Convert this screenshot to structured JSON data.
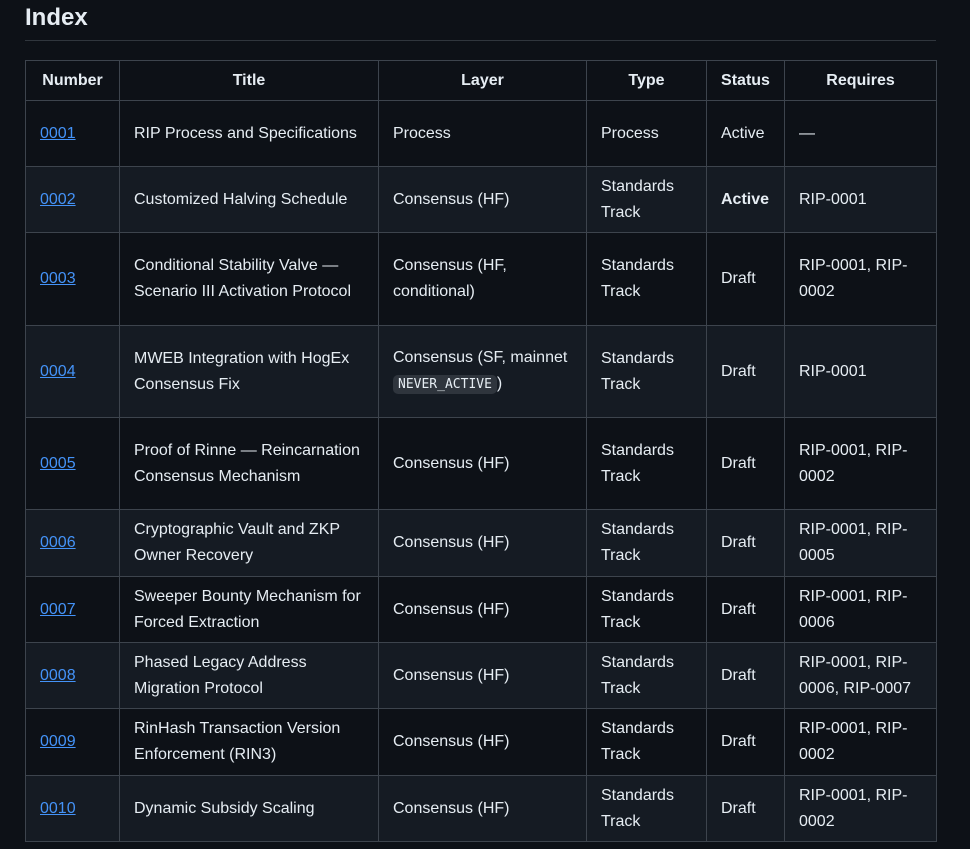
{
  "page": {
    "heading": "Index"
  },
  "table": {
    "headers": [
      "Number",
      "Title",
      "Layer",
      "Type",
      "Status",
      "Requires"
    ],
    "rows": [
      {
        "number": "0001",
        "title": "RIP Process and Specifications",
        "layer": "Process",
        "layer_code": "",
        "layer_suffix": "",
        "type": "Process",
        "status": "Active",
        "status_strong": false,
        "requires": "—"
      },
      {
        "number": "0002",
        "title": "Customized Halving Schedule",
        "layer": "Consensus (HF)",
        "layer_code": "",
        "layer_suffix": "",
        "type": "Standards Track",
        "status": "Active",
        "status_strong": true,
        "requires": "RIP-0001"
      },
      {
        "number": "0003",
        "title": "Conditional Stability Valve — Scenario III Activation Protocol",
        "layer": "Consensus (HF, conditional)",
        "layer_code": "",
        "layer_suffix": "",
        "type": "Standards Track",
        "status": "Draft",
        "status_strong": false,
        "requires": "RIP-0001, RIP-0002"
      },
      {
        "number": "0004",
        "title": "MWEB Integration with HogEx Consensus Fix",
        "layer": "Consensus (SF, mainnet ",
        "layer_code": "NEVER_ACTIVE",
        "layer_suffix": ")",
        "type": "Standards Track",
        "status": "Draft",
        "status_strong": false,
        "requires": "RIP-0001"
      },
      {
        "number": "0005",
        "title": "Proof of Rinne — Reincarnation Consensus Mechanism",
        "layer": "Consensus (HF)",
        "layer_code": "",
        "layer_suffix": "",
        "type": "Standards Track",
        "status": "Draft",
        "status_strong": false,
        "requires": "RIP-0001, RIP-0002"
      },
      {
        "number": "0006",
        "title": "Cryptographic Vault and ZKP Owner Recovery",
        "layer": "Consensus (HF)",
        "layer_code": "",
        "layer_suffix": "",
        "type": "Standards Track",
        "status": "Draft",
        "status_strong": false,
        "requires": "RIP-0001, RIP-0005"
      },
      {
        "number": "0007",
        "title": "Sweeper Bounty Mechanism for Forced Extraction",
        "layer": "Consensus (HF)",
        "layer_code": "",
        "layer_suffix": "",
        "type": "Standards Track",
        "status": "Draft",
        "status_strong": false,
        "requires": "RIP-0001, RIP-0006"
      },
      {
        "number": "0008",
        "title": "Phased Legacy Address Migration Protocol",
        "layer": "Consensus (HF)",
        "layer_code": "",
        "layer_suffix": "",
        "type": "Standards Track",
        "status": "Draft",
        "status_strong": false,
        "requires": "RIP-0001, RIP-0006, RIP-0007"
      },
      {
        "number": "0009",
        "title": "RinHash Transaction Version Enforcement (RIN3)",
        "layer": "Consensus (HF)",
        "layer_code": "",
        "layer_suffix": "",
        "type": "Standards Track",
        "status": "Draft",
        "status_strong": false,
        "requires": "RIP-0001, RIP-0002"
      },
      {
        "number": "0010",
        "title": "Dynamic Subsidy Scaling",
        "layer": "Consensus (HF)",
        "layer_code": "",
        "layer_suffix": "",
        "type": "Standards Track",
        "status": "Draft",
        "status_strong": false,
        "requires": "RIP-0001, RIP-0002"
      }
    ]
  },
  "colors": {
    "background": "#0d1117",
    "row_alt": "#151b23",
    "border": "#3d444d",
    "link": "#4493f8",
    "text": "#e6edf3"
  }
}
